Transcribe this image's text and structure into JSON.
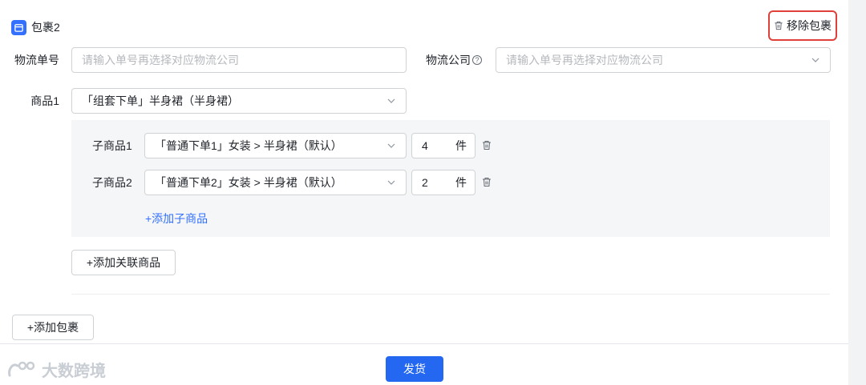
{
  "package": {
    "title": "包裹2",
    "remove_label": "移除包裹"
  },
  "logistics": {
    "tracking_label": "物流单号",
    "tracking_placeholder": "请输入单号再选择对应物流公司",
    "company_label": "物流公司",
    "company_help": "?",
    "company_placeholder": "请输入单号再选择对应物流公司"
  },
  "product": {
    "label": "商品1",
    "value": "「组套下单」半身裙（半身裙）",
    "sub_items": [
      {
        "label": "子商品1",
        "value": "「普通下单1」女装 > 半身裙（默认）",
        "qty": "4",
        "unit": "件"
      },
      {
        "label": "子商品2",
        "value": "「普通下单2」女装 > 半身裙（默认）",
        "qty": "2",
        "unit": "件"
      }
    ],
    "add_sub_label": "+添加子商品"
  },
  "actions": {
    "add_related_label": "+添加关联商品",
    "add_package_label": "+添加包裹",
    "ship_label": "发货"
  },
  "watermark": {
    "text": "大数跨境"
  },
  "colors": {
    "primary": "#2468f2",
    "link": "#3370ff",
    "highlight_border": "#e0403a"
  }
}
